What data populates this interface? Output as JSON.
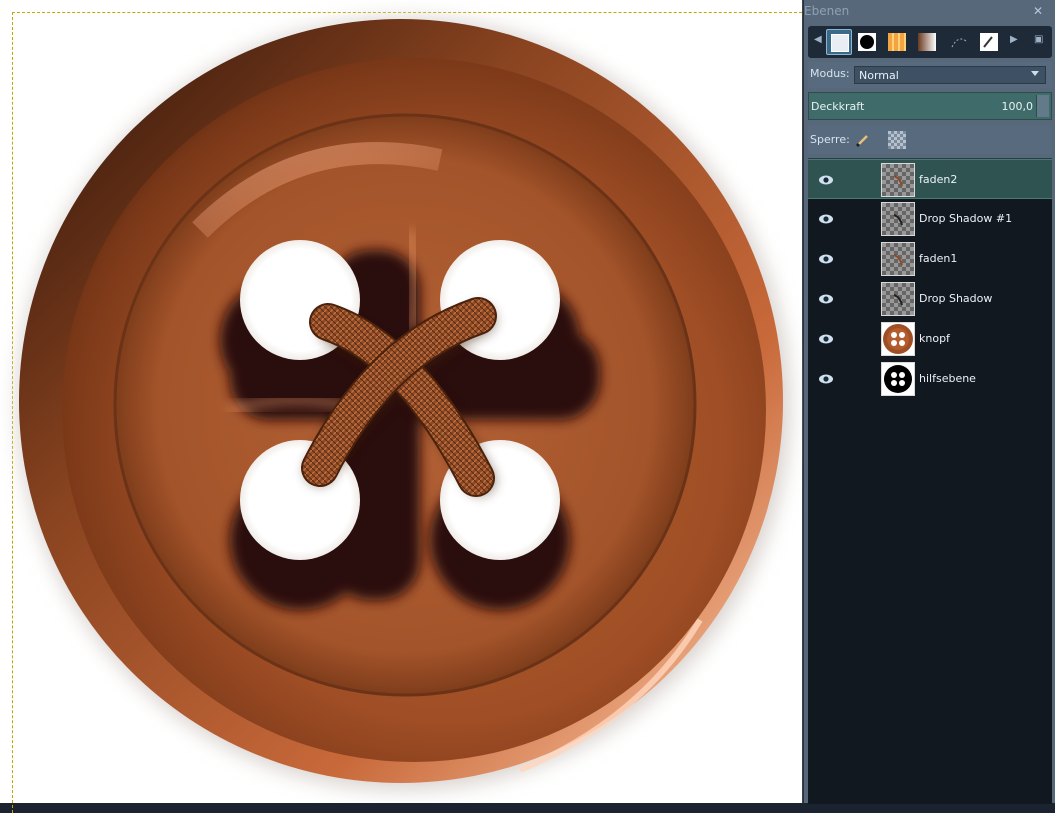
{
  "panel": {
    "title": "Ebenen",
    "close_icon": "close-icon",
    "mode_label": "Modus:",
    "mode_value": "Normal",
    "opacity_label": "Deckkraft",
    "opacity_value": "100,0",
    "lock_label": "Sperre:"
  },
  "tabs": [
    {
      "name": "layers-tab",
      "icon": "layers-icon"
    },
    {
      "name": "channels-tab",
      "icon": "circle-icon"
    },
    {
      "name": "gradients-tab",
      "icon": "gradient-orange-icon"
    },
    {
      "name": "gradient-tab",
      "icon": "gradient-brown-icon"
    },
    {
      "name": "paths-tab",
      "icon": "paths-icon"
    },
    {
      "name": "brushes-tab",
      "icon": "brush-icon"
    }
  ],
  "layers": [
    {
      "name": "faden2",
      "selected": true,
      "thumb": "thread"
    },
    {
      "name": "Drop Shadow #1",
      "selected": false,
      "thumb": "shadow"
    },
    {
      "name": "faden1",
      "selected": false,
      "thumb": "thread"
    },
    {
      "name": "Drop Shadow",
      "selected": false,
      "thumb": "shadow"
    },
    {
      "name": "knopf",
      "selected": false,
      "thumb": "button"
    },
    {
      "name": "hilfsebene",
      "selected": false,
      "thumb": "holes"
    }
  ],
  "colors": {
    "accent": "#3f6c6a",
    "button_base": "#a4542a",
    "button_dark": "#2a1108"
  }
}
